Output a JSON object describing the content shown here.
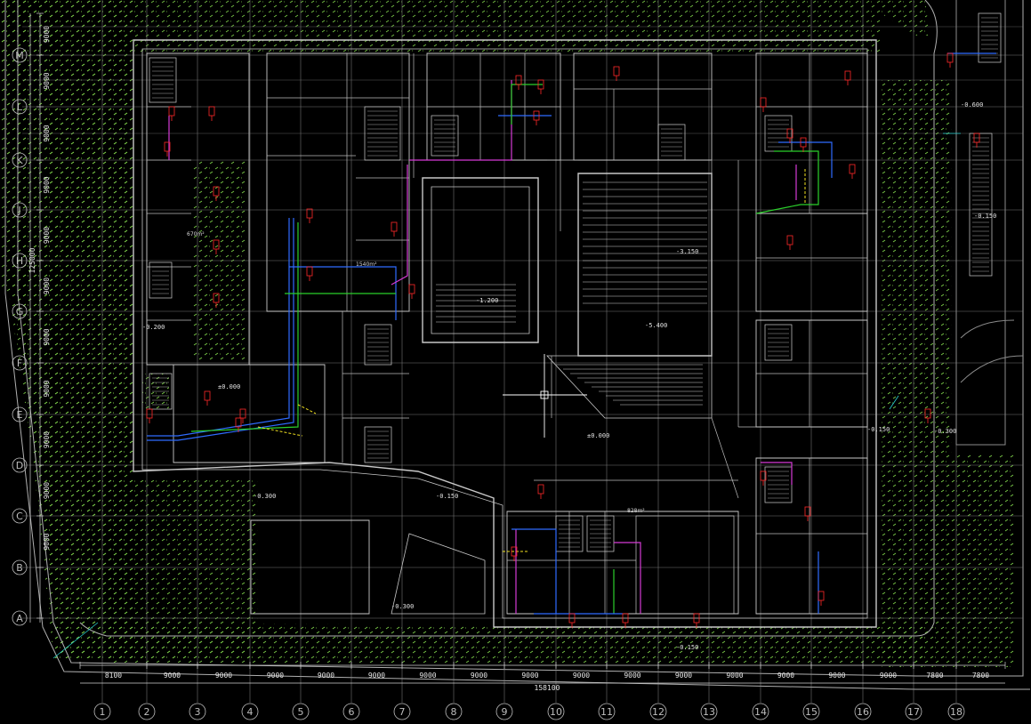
{
  "drawing": {
    "colors": {
      "background": "#000000",
      "wall": "#c8c8c8",
      "grid": "#9a9a9a",
      "hatch": "#7fd34a",
      "pipe_blue": "#2f6bff",
      "pipe_green": "#2bd02b",
      "pipe_magenta": "#d63bd6",
      "pipe_yellow": "#f0e020",
      "annot_red": "#ff2a2a",
      "annot_cyan": "#28d0d0"
    },
    "bottom_dims": [
      "8100",
      "9000",
      "9000",
      "9000",
      "9000",
      "9000",
      "9000",
      "9000",
      "9000",
      "9000",
      "9000",
      "9000",
      "9000",
      "9000",
      "9000",
      "9000",
      "7800",
      "7800"
    ],
    "bottom_total": "158100",
    "col_axes": [
      "1",
      "2",
      "3",
      "4",
      "5",
      "6",
      "7",
      "8",
      "9",
      "10",
      "11",
      "12",
      "13",
      "14",
      "15",
      "16",
      "17",
      "18"
    ],
    "left_dims": [
      "9000",
      "9000",
      "9000",
      "9000",
      "9000",
      "9000",
      "9000",
      "9000",
      "9000",
      "9000",
      "9000"
    ],
    "left_total": "125000",
    "row_axes": [
      "M",
      "L",
      "K",
      "J",
      "H",
      "G",
      "F",
      "E",
      "D",
      "C",
      "B",
      "A"
    ],
    "area_labels": [
      "670m²",
      "1540m²",
      "828m²"
    ],
    "elevations": [
      "-0.200",
      "±0.000",
      "-0.150",
      "±0.000",
      "-0.300",
      "-0.300",
      "-0.150",
      "-0.150",
      "-0.300",
      "-0.600",
      "-0.150",
      "-1.200",
      "-3.150",
      "-5.400"
    ]
  }
}
